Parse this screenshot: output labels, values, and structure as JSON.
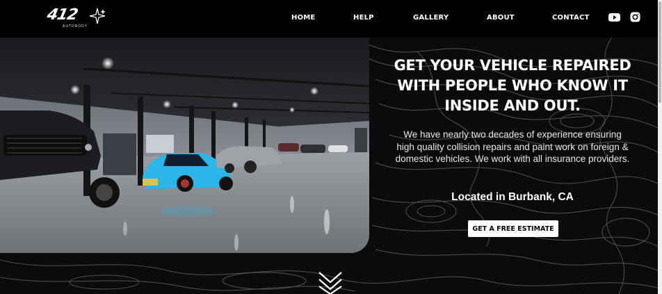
{
  "brand": {
    "logo_text": "412",
    "logo_subtext": "AUTOBODY"
  },
  "nav": {
    "home": "HOME",
    "help": "HELP",
    "gallery": "GALLERY",
    "about": "ABOUT",
    "contact": "CONTACT"
  },
  "social": {
    "youtube_icon": "youtube-icon",
    "instagram_icon": "instagram-icon"
  },
  "hero": {
    "image_alt": "garage-showroom-photo",
    "headline_lines": [
      "GET YOUR VEHICLE REPAIRED",
      "WITH PEOPLE WHO KNOW IT",
      "INSIDE AND OUT."
    ],
    "description": "We have nearly two decades of experience ensuring high quality collision repairs and paint work on foreign & domestic vehicles. We work with all insurance providers.",
    "location": "Located in Burbank, CA",
    "cta_label": "GET A FREE ESTIMATE"
  },
  "colors": {
    "background": "#000000",
    "accent_car": "#2bb5e8",
    "text": "#ffffff"
  }
}
